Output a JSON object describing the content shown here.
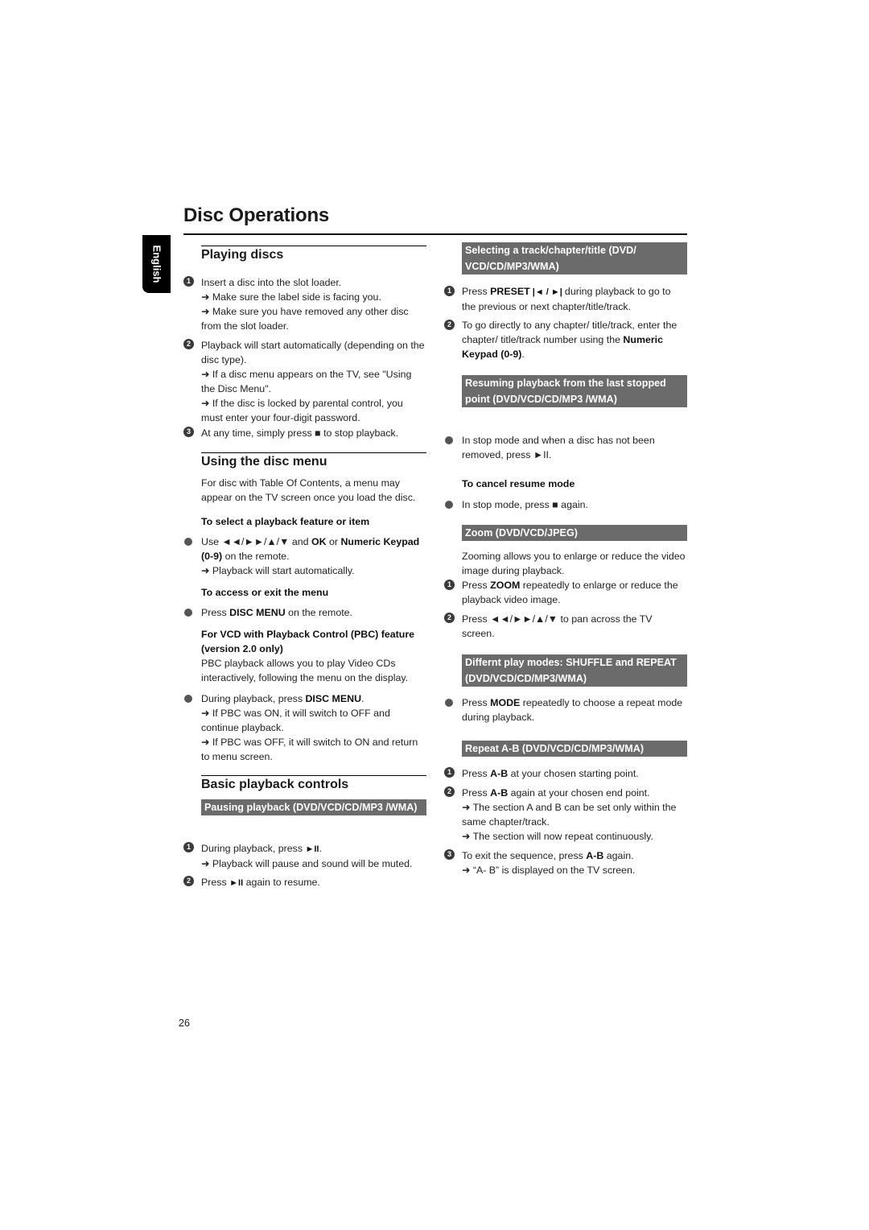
{
  "page": {
    "title": "Disc Operations",
    "language_tab": "English",
    "page_number": "26"
  },
  "left": {
    "playing_discs": {
      "heading": "Playing discs",
      "steps": [
        {
          "n": "1",
          "text": "Insert a disc into the slot loader.",
          "notes": [
            "➜ Make sure the label side is facing you.",
            "➜ Make sure you have removed any other disc from the slot loader."
          ]
        },
        {
          "n": "2",
          "text": "Playback will start automatically (depending on the disc type).",
          "notes": [
            "➜ If a disc menu appears on the TV, see \"Using the Disc Menu\".",
            "➜ If the disc is locked by parental control, you must enter your four-digit password."
          ]
        },
        {
          "n": "3",
          "text": "At any time, simply press ■ to stop playback."
        }
      ]
    },
    "disc_menu": {
      "heading": "Using the disc menu",
      "intro": "For disc with Table Of Contents, a menu may appear on the TV screen once you load the disc.",
      "select_heading": "To select a playback feature or item",
      "select_bullet_pre": "Use ◄◄/►►/▲/▼  and ",
      "select_ok": "OK",
      "select_or": " or ",
      "select_numeric": "Numeric Keypad (0-9)",
      "select_post": " on the remote.",
      "select_note": "➜ Playback will start automatically.",
      "access_heading": "To access or exit the menu",
      "access_pre": " Press ",
      "access_key": "DISC MENU",
      "access_post": " on the remote.",
      "pbc_heading": "For VCD with Playback Control (PBC) feature (version 2.0 only)",
      "pbc_intro": "PBC playback allows you to play Video CDs interactively, following the menu on the display.",
      "pbc_bullet_pre": "During playback, press ",
      "pbc_bullet_key": "DISC MENU",
      "pbc_bullet_post": ".",
      "pbc_notes": [
        "➜ If PBC was ON, it will switch to OFF and continue playback.",
        "➜ If PBC was OFF, it will switch to ON and return to menu screen."
      ]
    },
    "basic": {
      "heading": "Basic playback controls",
      "banner": "Pausing playback (DVD/VCD/CD/MP3 /WMA)",
      "step1_pre": "During playback, press ",
      "step1_key": "►II",
      "step1_post": ".",
      "step1_note": "➜ Playback will pause and sound will be muted.",
      "step2_pre": "Press ",
      "step2_key": "►II",
      "step2_post": " again to resume."
    }
  },
  "right": {
    "selecting": {
      "banner": "Selecting a track/chapter/title (DVD/ VCD/CD/MP3/WMA)",
      "step1_pre": "Press ",
      "step1_key": "PRESET",
      "step1_sym": " |◄ / ►| ",
      "step1_post": "during playback to go to the previous or next chapter/title/track.",
      "step2_pre": "To go directly to any chapter/ title/track, enter the chapter/ title/track number using the ",
      "step2_key": "Numeric Keypad (0-9)",
      "step2_post": "."
    },
    "resuming": {
      "banner": "Resuming playback from the last stopped point (DVD/VCD/CD/MP3 /WMA)",
      "bullet": "In stop mode and when a disc has not been removed, press ►II.",
      "cancel_heading": "To cancel resume mode",
      "cancel_bullet": " In stop mode, press ■ again."
    },
    "zoom": {
      "banner": "Zoom (DVD/VCD/JPEG)",
      "intro": "Zooming allows you to enlarge or reduce the video image during playback.",
      "step1_pre": "Press ",
      "step1_key": "ZOOM",
      "step1_post": " repeatedly to enlarge or reduce the playback video image.",
      "step2": "Press ◄◄/►►/▲/▼ to pan across the TV screen."
    },
    "modes": {
      "banner": "Differnt play modes: SHUFFLE and REPEAT (DVD/VCD/CD/MP3/WMA)",
      "bullet_pre": "Press ",
      "bullet_key": "MODE",
      "bullet_post": " repeatedly to choose a repeat mode during playback."
    },
    "repeat_ab": {
      "banner": "Repeat A-B (DVD/VCD/CD/MP3/WMA)",
      "key": "A-B",
      "step1_pre": "Press ",
      "step1_post": " at your chosen starting point.",
      "step2_pre": "Press ",
      "step2_post": " again at your chosen end point.",
      "step2_notes": [
        "➜ The section A and B can be set only within the same chapter/track.",
        "➜ The section will now repeat continuously."
      ],
      "step3_pre": "To exit the sequence, press ",
      "step3_post": " again.",
      "step3_note": "➜ “A- B” is displayed on the TV screen."
    }
  }
}
